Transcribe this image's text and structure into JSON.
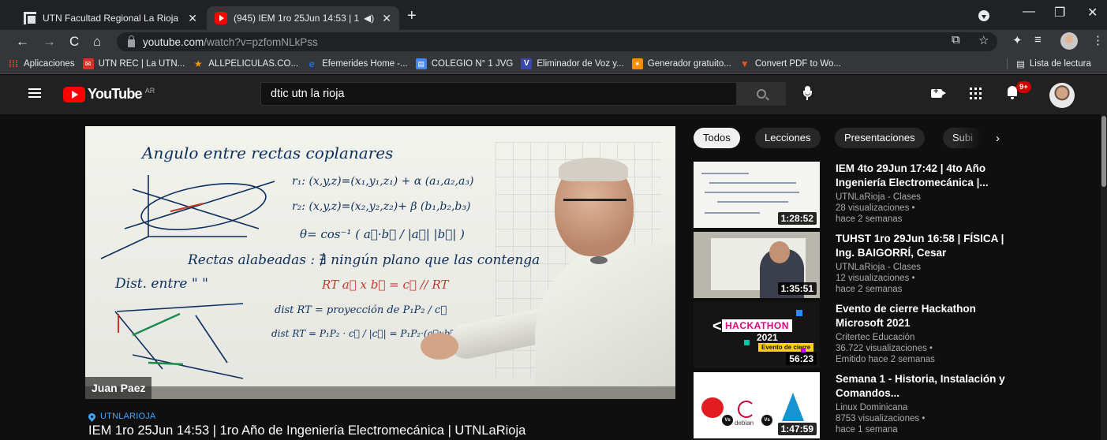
{
  "browser": {
    "tabs": [
      {
        "title": "UTN Facultad Regional La Rioja",
        "active": false
      },
      {
        "title": "(945) IEM 1ro 25Jun 14:53 | 1",
        "active": true,
        "audio": true
      }
    ],
    "new_tab": "+",
    "url": {
      "host": "youtube.com",
      "path": "/watch?v=pzfomNLkPss"
    },
    "bookmarks": [
      {
        "label": "Aplicaciones",
        "icon": "apps-grid-icon",
        "color": "#ea4335"
      },
      {
        "label": "UTN REC | La UTN...",
        "icon": "mail-icon",
        "color": "#d93025"
      },
      {
        "label": "ALLPELICULAS.CO...",
        "icon": "star-icon",
        "color": "#f29900"
      },
      {
        "label": "Efemerides Home -...",
        "icon": "efemerides-icon",
        "color": "#1a73e8"
      },
      {
        "label": "COLEGIO N° 1 JVG",
        "icon": "school-icon",
        "color": "#4285f4"
      },
      {
        "label": "Eliminador de Voz y...",
        "icon": "v-icon",
        "color": "#3949ab"
      },
      {
        "label": "Generador gratuito...",
        "icon": "generator-icon",
        "color": "#fb8c00"
      },
      {
        "label": "Convert PDF to Wo...",
        "icon": "convert-icon",
        "color": "#f4511e"
      }
    ],
    "reading_list": "Lista de lectura"
  },
  "youtube": {
    "logo_text": "YouTube",
    "country_code": "AR",
    "search_query": "dtic utn la rioja",
    "notification_count": "9+",
    "accent_color": "#ff0000"
  },
  "video": {
    "presenter_watermark": "Juan Paez",
    "channel_tag": "UTNLARIOJA",
    "title": "IEM 1ro 25Jun 14:53 | 1ro Año de Ingeniería Electromecánica | UTNLaRioja",
    "board_text": {
      "title": "Angulo entre rectas coplanares",
      "r1": "r₁: (x,y,z)=(x₁,y₁,z₁) + α (a₁,a₂,a₃)",
      "r2": "r₂: (x,y,z)=(x₂,y₂,z₂)+ β (b₁,b₂,b₃)",
      "theta": "θ= cos⁻¹ ( a⃗·b⃗ / |a⃗| |b⃗| )",
      "alabeadas": "Rectas alabeadas : ∄ ningún plano que las contenga",
      "dist": "Dist. entre   \"     \"",
      "rt": "RT   a⃗ x b⃗ = c⃗ // RT",
      "dist1": "dist RT = proyección de P₁P₂ / c⃗",
      "dist2": "dist RT = P₁P₂ · c⃗ / |c⃗| = P₁P₂·(a⃗xb⃗) / |a⃗xb⃗|"
    }
  },
  "chips": [
    "Todos",
    "Lecciones",
    "Presentaciones",
    "Subi"
  ],
  "recommendations": [
    {
      "title": "IEM 4to 29Jun 17:42 | 4to Año Ingeniería Electromecánica |...",
      "channel": "UTNLaRioja - Clases",
      "views": "28 visualizaciones •",
      "age": "hace 2 semanas",
      "duration": "1:28:52"
    },
    {
      "title": "TUHST 1ro 29Jun 16:58 | FÍSICA | Ing. BAIGORRÍ, Cesar",
      "channel": "UTNLaRioja - Clases",
      "views": "12 visualizaciones •",
      "age": "hace 2 semanas",
      "duration": "1:35:51"
    },
    {
      "title": "Evento de cierre Hackathon Microsoft 2021",
      "channel": "Critertec Educación",
      "views": "36.722 visualizaciones •",
      "age": "Emitido hace 2 semanas",
      "duration": "56:23",
      "thumb_text": {
        "hackathon": "HACKATHON",
        "year": "2021",
        "event": "Evento de cierre"
      }
    },
    {
      "title": "Semana 1 - Historia, Instalación y Comandos...",
      "channel": "Linux Dominicana",
      "views": "8753 visualizaciones •",
      "age": "hace 1 semana",
      "duration": "1:47:59",
      "thumb_text": {
        "vs": "Vs",
        "debian": "debian"
      }
    }
  ]
}
